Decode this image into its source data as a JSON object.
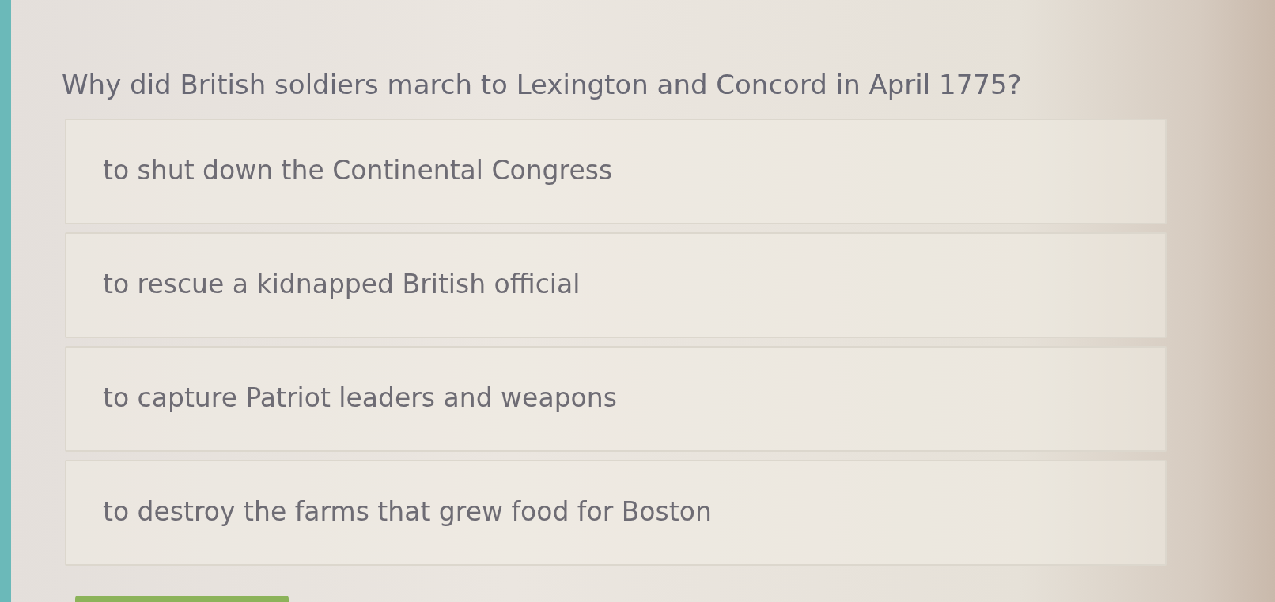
{
  "question": "Why did British soldiers march to Lexington and Concord in April 1775?",
  "answers": [
    {
      "text": "to shut down the Continental Congress",
      "selected": false
    },
    {
      "text": "to rescue a kidnapped British official",
      "selected": false
    },
    {
      "text": "to capture Patriot leaders and weapons",
      "selected": false
    },
    {
      "text": "to destroy the farms that grew food for Boston",
      "selected": false
    }
  ]
}
